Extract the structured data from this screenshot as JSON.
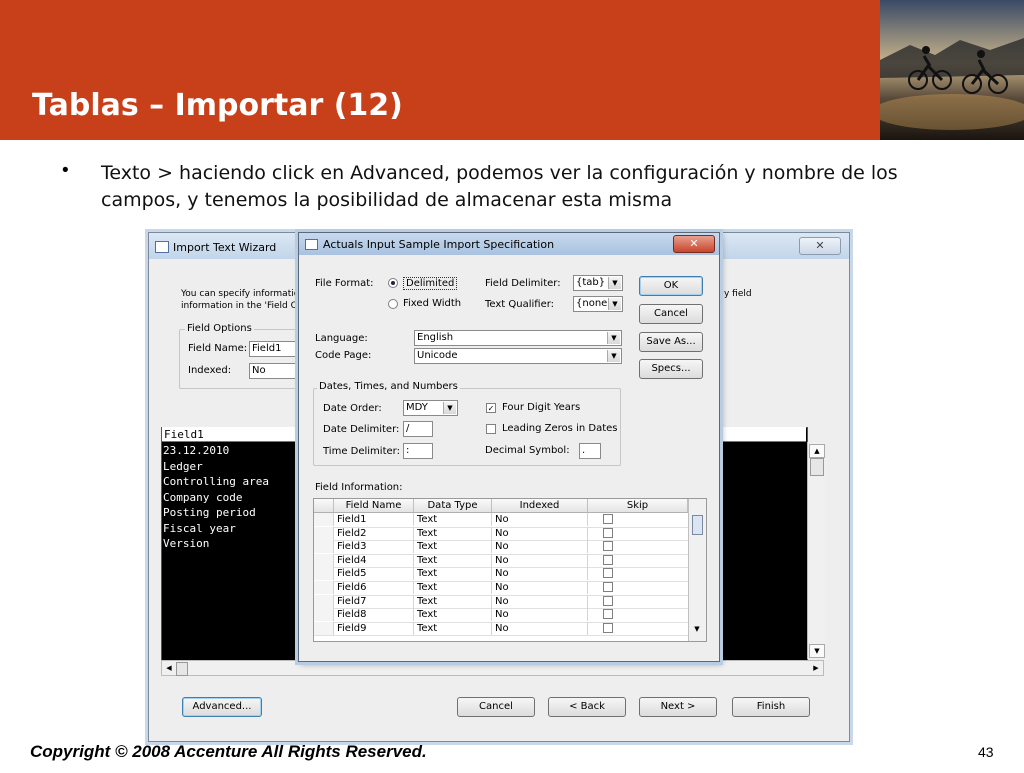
{
  "slide": {
    "title": "Tablas – Importar (12)",
    "bullet": "Texto > haciendo click en Advanced, podemos ver la configuración y nombre de los campos, y tenemos la posibilidad de almacenar esta misma",
    "footer": "Copyright © 2008 Accenture All Rights Reserved.",
    "page_number": "43"
  },
  "wizard": {
    "title": "Import Text Wizard",
    "intro": "You can specify information",
    "intro2": "information in the 'Field Op",
    "intro_right": "y field",
    "field_options_legend": "Field Options",
    "field_name_label": "Field Name:",
    "field_name_value": "Field1",
    "indexed_label": "Indexed:",
    "indexed_value": "No",
    "preview_header": "Field1",
    "preview_lines": [
      "23.12.2010",
      "Ledger",
      "Controlling area",
      "Company code",
      "Posting period",
      "Fiscal year",
      "Version"
    ],
    "buttons": {
      "advanced": "Advanced...",
      "cancel": "Cancel",
      "back": "< Back",
      "next": "Next >",
      "finish": "Finish"
    }
  },
  "dialog": {
    "title": "Actuals Input Sample Import Specification",
    "close": "✕",
    "file_format_label": "File Format:",
    "delimited": "Delimited",
    "fixed_width": "Fixed Width",
    "field_delimiter_label": "Field Delimiter:",
    "field_delimiter_value": "{tab}",
    "text_qualifier_label": "Text Qualifier:",
    "text_qualifier_value": "{none}",
    "language_label": "Language:",
    "language_value": "English",
    "code_page_label": "Code Page:",
    "code_page_value": "Unicode",
    "dates_legend": "Dates, Times, and Numbers",
    "date_order_label": "Date Order:",
    "date_order_value": "MDY",
    "date_delimiter_label": "Date Delimiter:",
    "date_delimiter_value": "/",
    "time_delimiter_label": "Time Delimiter:",
    "time_delimiter_value": ":",
    "four_digit_years": "Four Digit Years",
    "four_digit_checked": true,
    "leading_zeros": "Leading Zeros in Dates",
    "decimal_symbol_label": "Decimal Symbol:",
    "decimal_symbol_value": ".",
    "field_information_label": "Field Information:",
    "buttons": {
      "ok": "OK",
      "cancel": "Cancel",
      "save_as": "Save As...",
      "specs": "Specs..."
    },
    "grid": {
      "headers": [
        "Field Name",
        "Data Type",
        "Indexed",
        "Skip"
      ],
      "rows": [
        [
          "Field1",
          "Text",
          "No"
        ],
        [
          "Field2",
          "Text",
          "No"
        ],
        [
          "Field3",
          "Text",
          "No"
        ],
        [
          "Field4",
          "Text",
          "No"
        ],
        [
          "Field5",
          "Text",
          "No"
        ],
        [
          "Field6",
          "Text",
          "No"
        ],
        [
          "Field7",
          "Text",
          "No"
        ],
        [
          "Field8",
          "Text",
          "No"
        ],
        [
          "Field9",
          "Text",
          "No"
        ]
      ]
    }
  }
}
